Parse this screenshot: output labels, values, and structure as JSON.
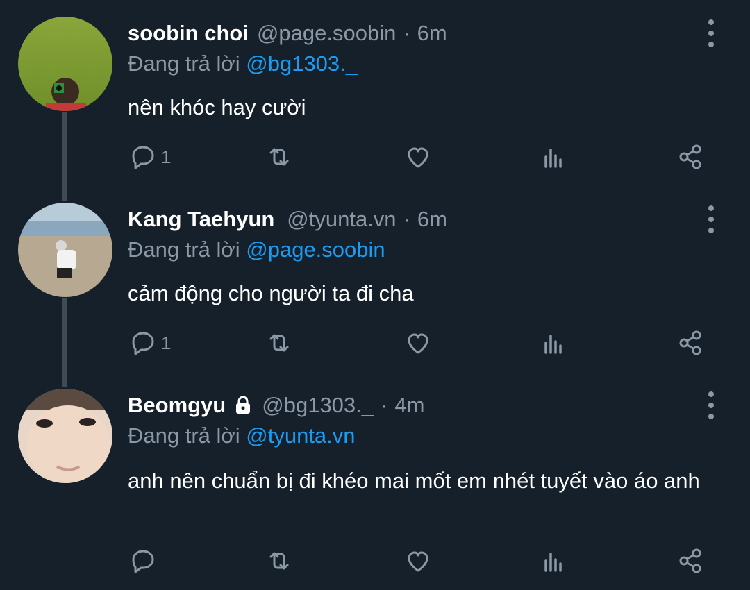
{
  "tweets": [
    {
      "name": "soobin choi",
      "handle": "@page.soobin",
      "separator": "·",
      "time": "6m",
      "replying_prefix": "Đang trả lời",
      "replying_to": "@bg1303._",
      "text": "nên khóc hay cười",
      "reply_count": "1",
      "locked": false
    },
    {
      "name": "Kang Taehyun",
      "handle": "@tyunta.vn",
      "separator": "·",
      "time": "6m",
      "replying_prefix": "Đang trả lời",
      "replying_to": "@page.soobin",
      "text": "cảm động cho người ta đi cha",
      "reply_count": "1",
      "locked": false
    },
    {
      "name": "Beomgyu",
      "handle": "@bg1303._",
      "separator": "·",
      "time": "4m",
      "replying_prefix": "Đang trả lời",
      "replying_to": "@tyunta.vn",
      "text": "anh nên chuẩn bị đi khéo mai mốt em nhét tuyết vào áo anh",
      "reply_count": "",
      "locked": true
    }
  ],
  "icons": {
    "reply": "reply-icon",
    "retweet": "retweet-icon",
    "like": "heart-icon",
    "analytics": "analytics-icon",
    "share": "share-icon",
    "more": "more-vertical-icon",
    "lock": "lock-icon"
  },
  "colors": {
    "background": "#15202b",
    "mention": "#1d9bf0",
    "secondary_text": "#8b98a5",
    "thread_line": "#3d4a57"
  }
}
